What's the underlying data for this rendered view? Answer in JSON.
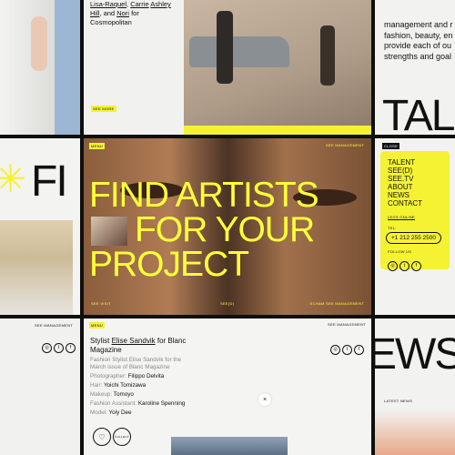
{
  "credits_top": {
    "names": [
      "Lisa-Raquel",
      "Carrie",
      "Ashley Hill",
      "Nori"
    ],
    "connector": ", and",
    "suffix": "for",
    "publication": "Cosmopolitan",
    "see_more": "SEE MORE"
  },
  "about_snippet": {
    "lines": [
      "management and r",
      "fashion, beauty, en",
      "provide each of ou",
      "strengths and goal"
    ],
    "big_word": "TAL"
  },
  "hero": {
    "menu": "MENU",
    "brand": "SEE MANAGEMENT",
    "headline": [
      "FIND ARTISTS",
      "FOR YOUR",
      "PROJECT"
    ],
    "footer_left": "SEE VISIT",
    "footer_mid": "SEE(D)",
    "footer_right": "ECHAM SEE MANAGEMENT"
  },
  "menu_panel": {
    "close": "CLOSE",
    "items": [
      "TALENT",
      "SEE(D)",
      "SEE.TV",
      "ABOUT",
      "NEWS",
      "CONTACT"
    ],
    "email": "LEGS ONLINE",
    "tel_label": "TEL:",
    "phone": "+1 212 255 2500",
    "follow": "FOLLOW US",
    "social": [
      "IG",
      "TW",
      "FB"
    ]
  },
  "left_mid": {
    "big": "FI",
    "glyph": "✳"
  },
  "left_bottom": {
    "brand": "SEE MANAGEMENT",
    "social": [
      "IG",
      "TW",
      "FB"
    ]
  },
  "article": {
    "menu": "MENU",
    "brand": "SEE MANAGEMENT",
    "title_pre": "Stylist",
    "title_name": "Elise Sandvik",
    "title_post": "for Blanc Magazine",
    "desc": "Fashion Stylist Elise Sandvik for the March issue of Blanc Magazine",
    "credits": [
      {
        "role": "Photographer:",
        "name": "Filippo Delvita"
      },
      {
        "role": "Hair:",
        "name": "Yoichi Tomizawa"
      },
      {
        "role": "Makeup:",
        "name": "Tomoyo"
      },
      {
        "role": "Fashion Assistant:",
        "name": "Karoline Spenning"
      },
      {
        "role": "Model:",
        "name": "Yoly Dee"
      }
    ],
    "collect": "COLLECT",
    "social": [
      "IG",
      "TW",
      "FB"
    ]
  },
  "news_tile": {
    "big": "EWS",
    "label": "LATEST NEWS"
  },
  "colors": {
    "accent_yellow": "#f4f233",
    "headline_yellow": "#ffff3a",
    "dark_bg": "#0f0f0f"
  }
}
